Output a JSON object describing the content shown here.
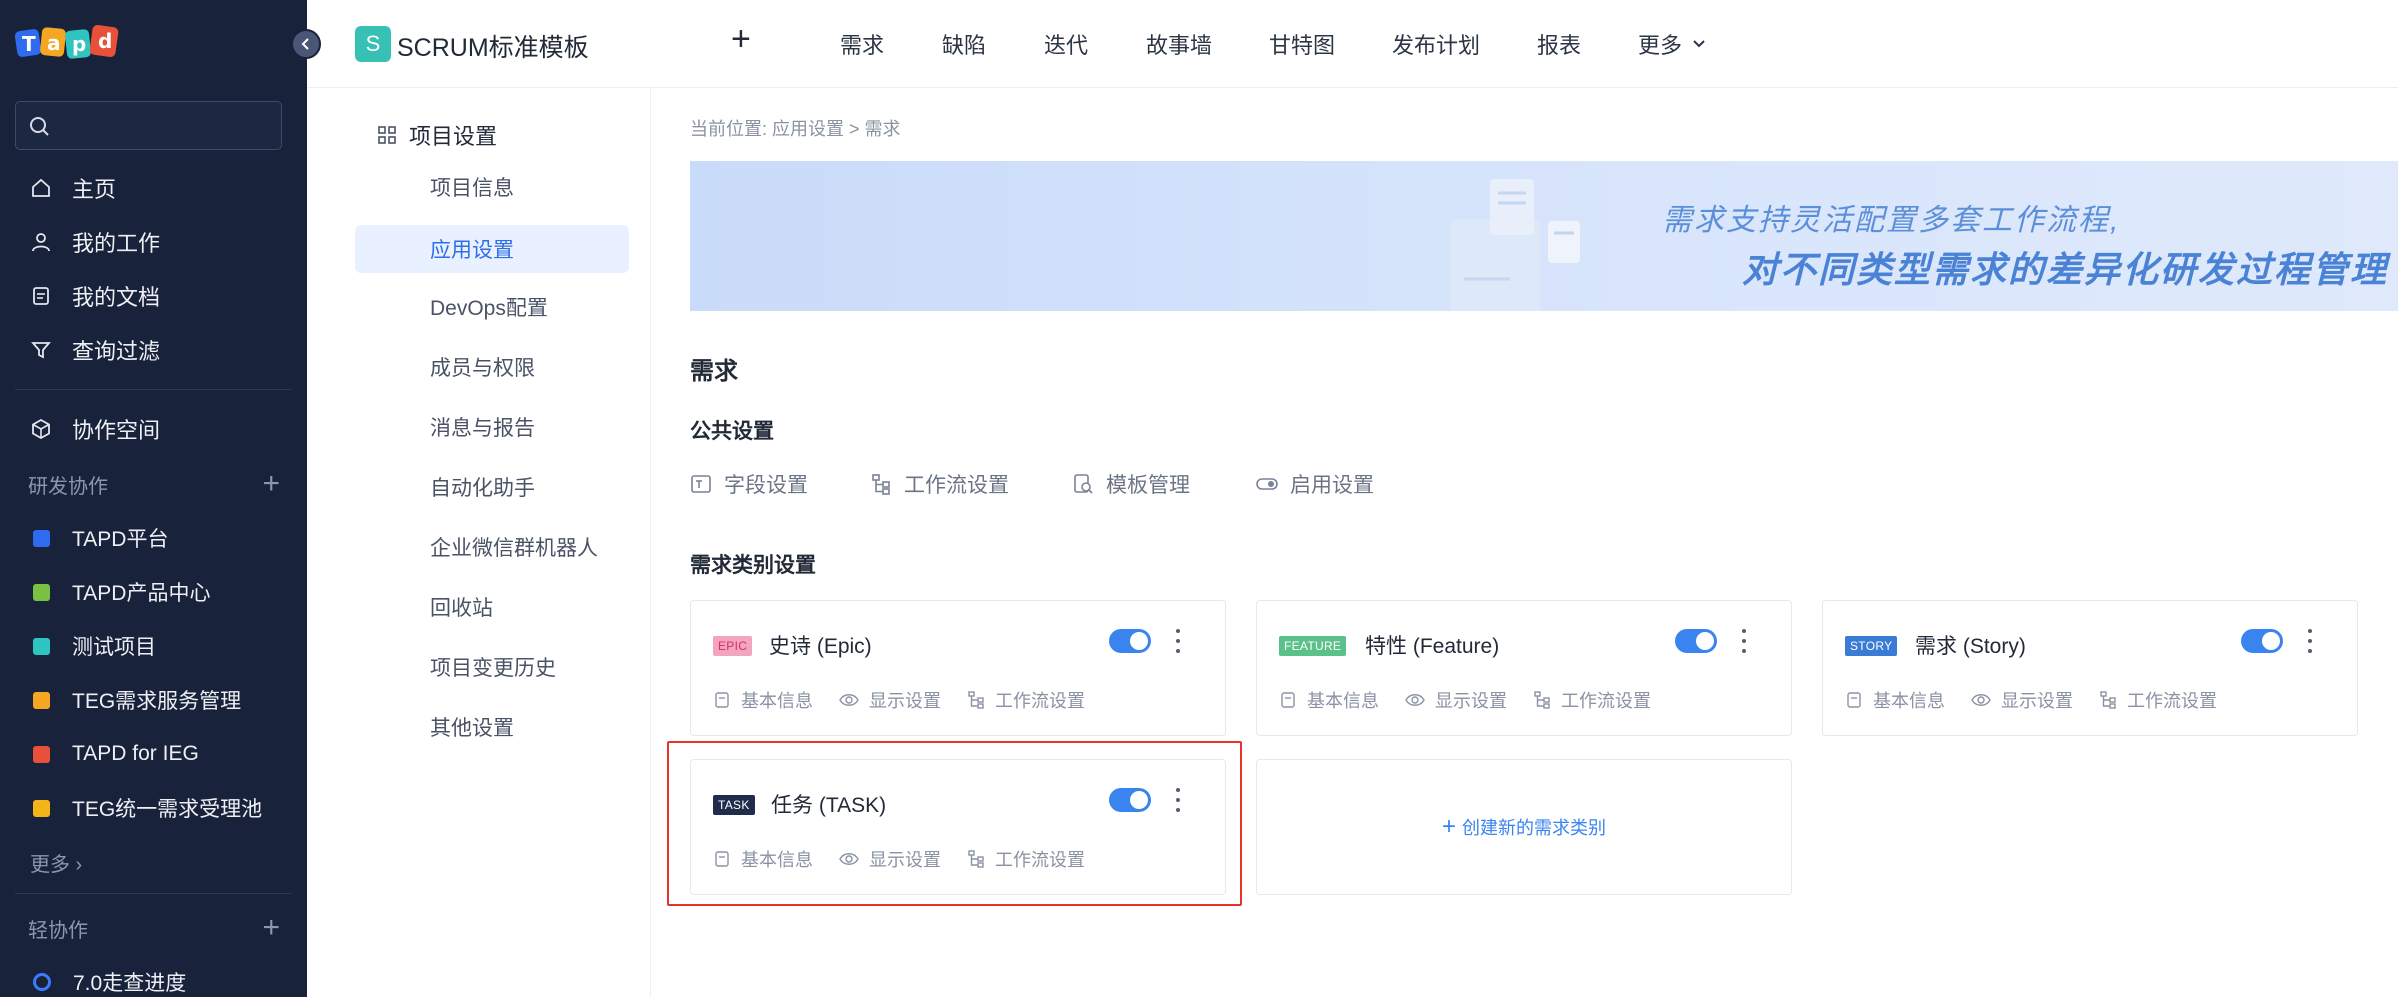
{
  "sidebar": {
    "logo_text": "Tapd",
    "search_placeholder": "",
    "nav": [
      {
        "label": "主页",
        "icon": "home-icon"
      },
      {
        "label": "我的工作",
        "icon": "user-icon"
      },
      {
        "label": "我的文档",
        "icon": "document-icon"
      },
      {
        "label": "查询过滤",
        "icon": "filter-icon"
      }
    ],
    "workspace_label": "协作空间",
    "rd_section": "研发协作",
    "projects": [
      {
        "label": "TAPD平台",
        "color": "#2f6bf0"
      },
      {
        "label": "TAPD产品中心",
        "color": "#7ac143"
      },
      {
        "label": "测试项目",
        "color": "#2fc4bf"
      },
      {
        "label": "TEG需求服务管理",
        "color": "#f5a623"
      },
      {
        "label": "TAPD for IEG",
        "color": "#e8503a"
      },
      {
        "label": "TEG统一需求受理池",
        "color": "#f5b417"
      }
    ],
    "more_label": "更多 ›",
    "light_section": "轻协作",
    "light_items": [
      {
        "label": "7.0走查进度"
      }
    ]
  },
  "topbar": {
    "project_initial": "S",
    "project_name": "SCRUM标准模板",
    "add_label": "+",
    "tabs": [
      "需求",
      "缺陷",
      "迭代",
      "故事墙",
      "甘特图",
      "发布计划",
      "报表",
      "更多"
    ]
  },
  "subnav": {
    "title": "项目设置",
    "items": [
      "项目信息",
      "应用设置",
      "DevOps配置",
      "成员与权限",
      "消息与报告",
      "自动化助手",
      "企业微信群机器人",
      "回收站",
      "项目变更历史",
      "其他设置"
    ],
    "active_index": 1
  },
  "main": {
    "breadcrumb": "当前位置:  应用设置 > 需求",
    "banner_line1": "需求支持灵活配置多套工作流程,",
    "banner_line2": "对不同类型需求的差异化研发过程管理",
    "title": "需求",
    "public_settings_title": "公共设置",
    "public_links": [
      "字段设置",
      "工作流设置",
      "模板管理",
      "启用设置"
    ],
    "category_title": "需求类别设置",
    "card_links": [
      "基本信息",
      "显示设置",
      "工作流设置"
    ],
    "cards": [
      {
        "tag": "EPIC",
        "tag_color": "#f06292",
        "name": "史诗 (Epic)",
        "enabled": true
      },
      {
        "tag": "FEATURE",
        "tag_color": "#4caf7a",
        "name": "特性 (Feature)",
        "enabled": true
      },
      {
        "tag": "STORY",
        "tag_color": "#3a7bd5",
        "name": "需求 (Story)",
        "enabled": true
      },
      {
        "tag": "TASK",
        "tag_color": "#1f2c4a",
        "name": "任务 (TASK)",
        "enabled": true
      }
    ],
    "create_label": "创建新的需求类别"
  }
}
